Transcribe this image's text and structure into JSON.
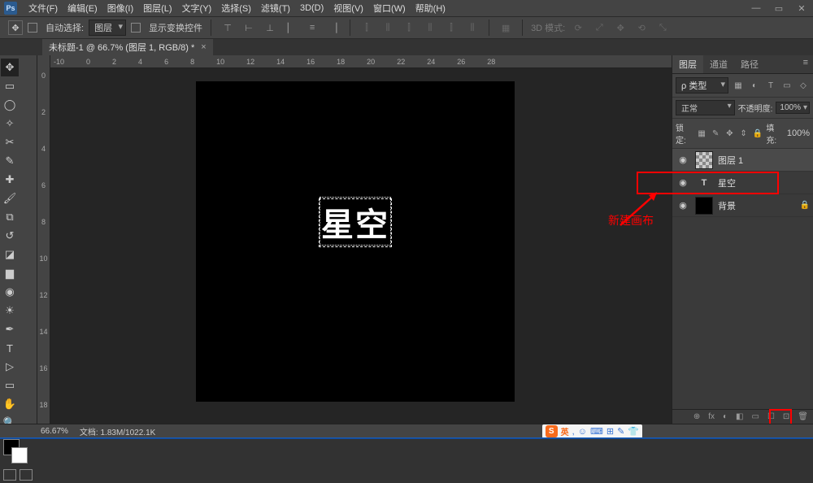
{
  "app": {
    "logo": "Ps"
  },
  "menu": [
    "文件(F)",
    "编辑(E)",
    "图像(I)",
    "图层(L)",
    "文字(Y)",
    "选择(S)",
    "滤镜(T)",
    "3D(D)",
    "视图(V)",
    "窗口(W)",
    "帮助(H)"
  ],
  "window_controls": {
    "min": "—",
    "max": "▭",
    "close": "✕"
  },
  "options": {
    "move_icon": "✥",
    "auto_select_label": "自动选择:",
    "auto_select_target": "图层",
    "show_transform": "显示变换控件",
    "mode_3d_label": "3D 模式:"
  },
  "document": {
    "tab_title": "未标题-1 @ 66.7% (图层 1, RGB/8) *",
    "close": "×"
  },
  "ruler_h": [
    "-10",
    "0",
    "2",
    "4",
    "6",
    "8",
    "10",
    "12",
    "14",
    "16",
    "18",
    "20",
    "22",
    "24",
    "26",
    "28"
  ],
  "ruler_v": [
    "0",
    "2",
    "4",
    "6",
    "8",
    "10",
    "12",
    "14",
    "16",
    "18"
  ],
  "canvas_text": "星空",
  "panels": {
    "tabs": {
      "layers": "图层",
      "channels": "通道",
      "paths": "路径"
    },
    "menu_icon": "≡",
    "filter_kind": "ρ 类型",
    "filter_icons": [
      "▦",
      "◐",
      "T",
      "▭",
      "◇"
    ],
    "blend_mode": "正常",
    "opacity_label": "不透明度:",
    "opacity_value": "100%",
    "lock_label": "锁定:",
    "lock_icons": [
      "▦",
      "✎",
      "✥",
      "⇕",
      "🔒"
    ],
    "fill_label": "填充:",
    "fill_value": "100%",
    "layers": [
      {
        "name": "图层 1",
        "thumb": "checker",
        "selected": true
      },
      {
        "name": "星空",
        "type": "T"
      },
      {
        "name": "背景",
        "thumb": "black",
        "locked": true
      }
    ],
    "bottom_icons": [
      "⊕",
      "fx",
      "◐",
      "◧",
      "▭",
      "☐",
      "⊡",
      "🗑"
    ]
  },
  "annotations": {
    "new_canvas": "新建画布"
  },
  "status": {
    "zoom": "66.67%",
    "doc_size": "文档: 1.83M/1022.1K"
  },
  "ime": {
    "logo": "S",
    "lang": "英",
    "icons": [
      ",",
      "☺",
      "⌨",
      "⊞",
      "✎",
      "👕"
    ]
  }
}
